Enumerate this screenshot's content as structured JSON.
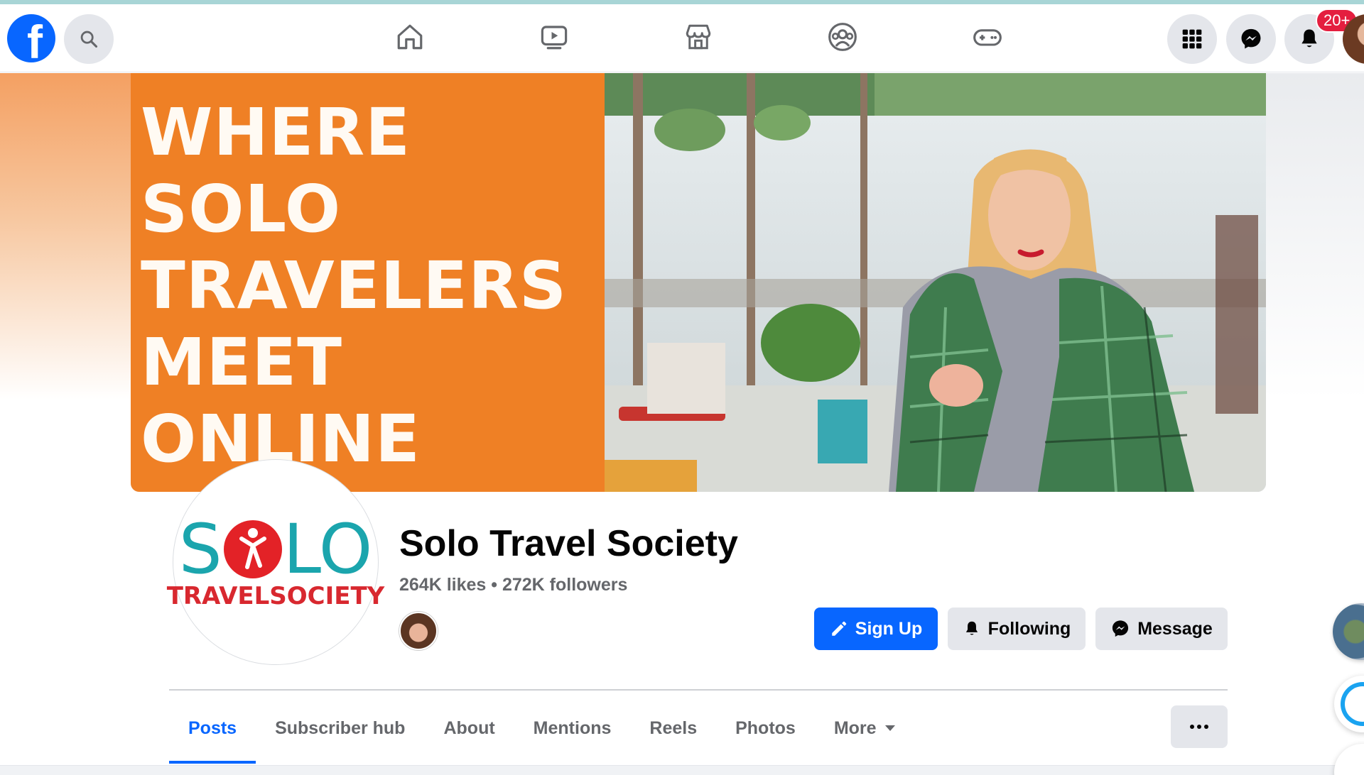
{
  "topbar": {
    "logo_letter": "f",
    "notification_badge": "20+",
    "nav_icons": [
      "home-icon",
      "watch-icon",
      "marketplace-icon",
      "groups-icon",
      "gaming-icon"
    ]
  },
  "cover": {
    "headline": "WHERE\nSOLO\nTRAVELERS\nMEET\nONLINE",
    "accent_color": "#ef8025"
  },
  "profile": {
    "logo_text_top_left": "S",
    "logo_text_top_right": "LO",
    "logo_text_bottom": "TRAVELSOCIETY",
    "page_name": "Solo Travel Society",
    "stats": "264K likes • 272K followers"
  },
  "actions": {
    "signup_label": "Sign Up",
    "following_label": "Following",
    "message_label": "Message"
  },
  "tabs": [
    {
      "label": "Posts",
      "active": true
    },
    {
      "label": "Subscriber hub",
      "active": false
    },
    {
      "label": "About",
      "active": false
    },
    {
      "label": "Mentions",
      "active": false
    },
    {
      "label": "Reels",
      "active": false
    },
    {
      "label": "Photos",
      "active": false
    },
    {
      "label": "More",
      "active": false
    }
  ],
  "colors": {
    "brand_blue": "#0866ff",
    "badge_red": "#e41e3f",
    "logo_teal": "#1ba5ad",
    "logo_red": "#d8282f"
  }
}
